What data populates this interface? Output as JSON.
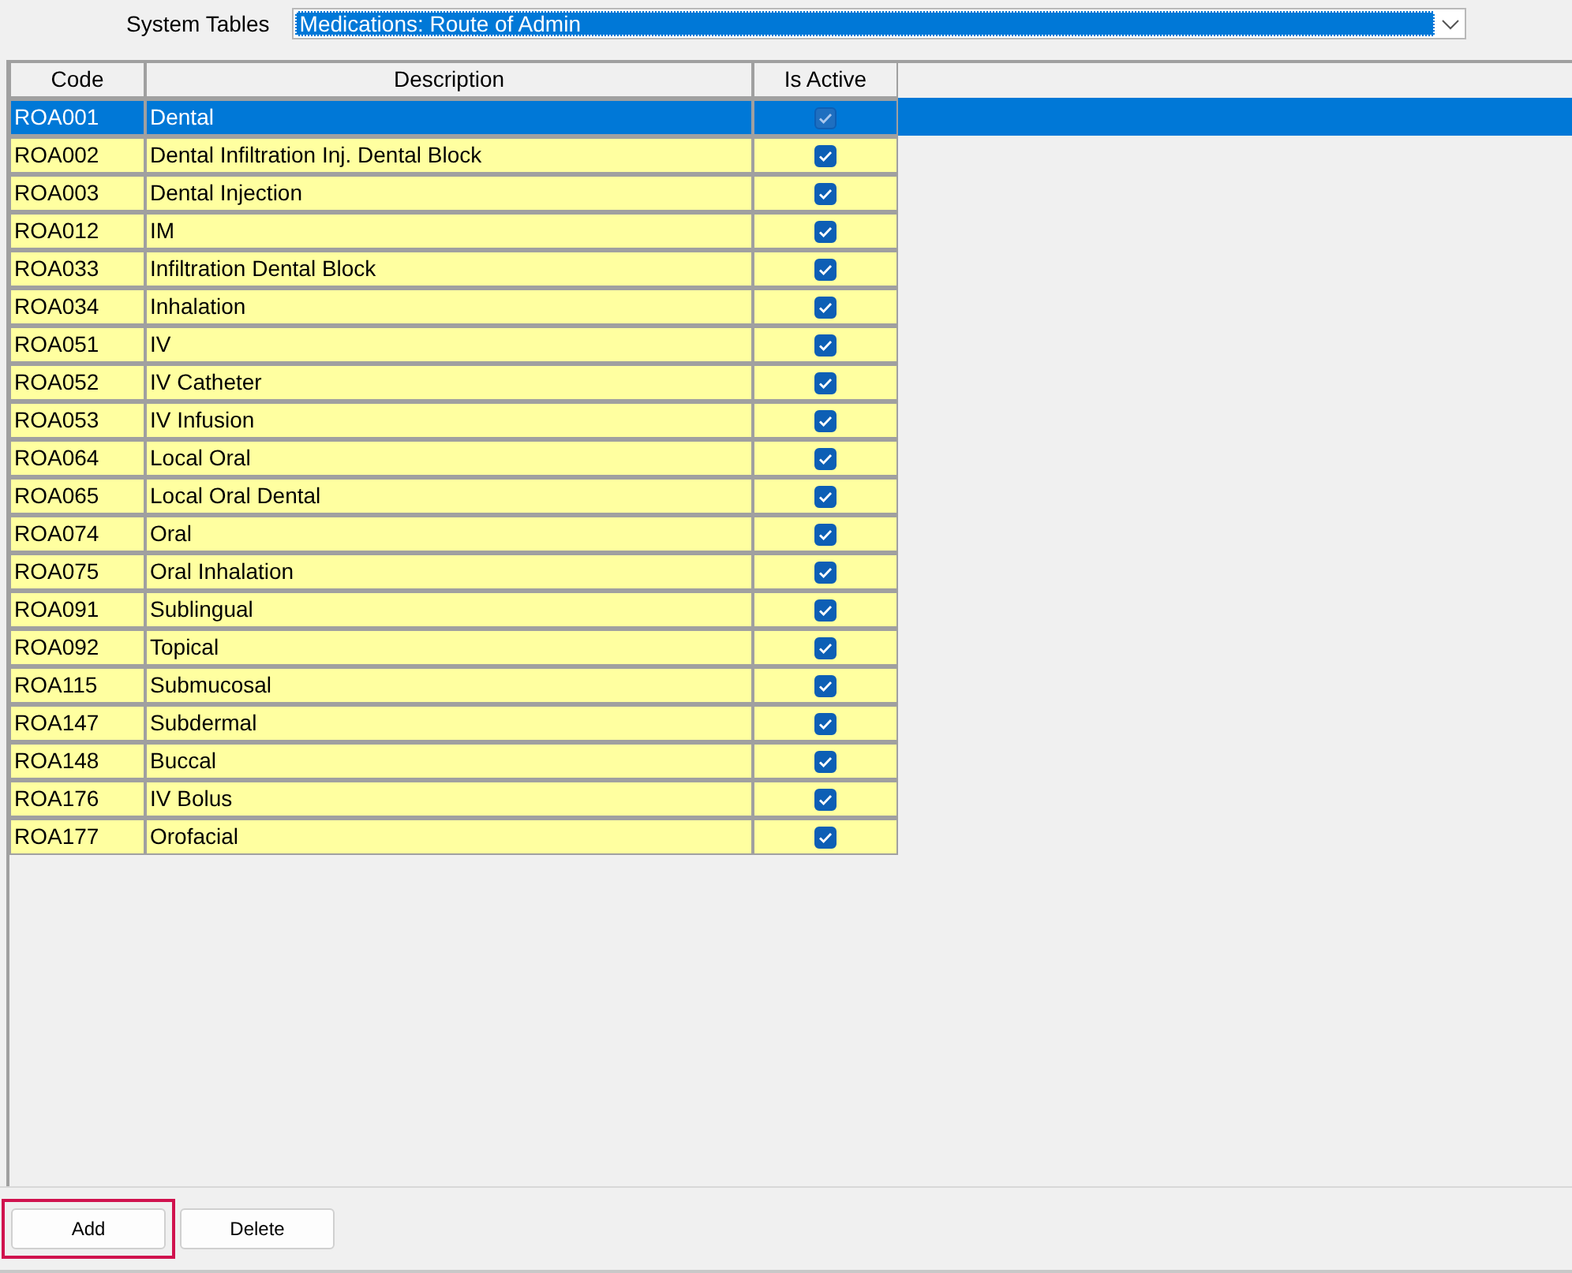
{
  "system_tables": {
    "label": "System Tables",
    "value": "Medications: Route of Admin"
  },
  "table": {
    "columns": [
      "Code",
      "Description",
      "Is Active"
    ],
    "rows": [
      {
        "code": "ROA001",
        "description": "Dental",
        "active": true,
        "selected": true
      },
      {
        "code": "ROA002",
        "description": "Dental Infiltration Inj. Dental Block",
        "active": true,
        "selected": false
      },
      {
        "code": "ROA003",
        "description": "Dental Injection",
        "active": true,
        "selected": false
      },
      {
        "code": "ROA012",
        "description": "IM",
        "active": true,
        "selected": false
      },
      {
        "code": "ROA033",
        "description": "Infiltration Dental Block",
        "active": true,
        "selected": false
      },
      {
        "code": "ROA034",
        "description": "Inhalation",
        "active": true,
        "selected": false
      },
      {
        "code": "ROA051",
        "description": "IV",
        "active": true,
        "selected": false
      },
      {
        "code": "ROA052",
        "description": "IV Catheter",
        "active": true,
        "selected": false
      },
      {
        "code": "ROA053",
        "description": "IV Infusion",
        "active": true,
        "selected": false
      },
      {
        "code": "ROA064",
        "description": "Local Oral",
        "active": true,
        "selected": false
      },
      {
        "code": "ROA065",
        "description": "Local Oral Dental",
        "active": true,
        "selected": false
      },
      {
        "code": "ROA074",
        "description": "Oral",
        "active": true,
        "selected": false
      },
      {
        "code": "ROA075",
        "description": "Oral Inhalation",
        "active": true,
        "selected": false
      },
      {
        "code": "ROA091",
        "description": "Sublingual",
        "active": true,
        "selected": false
      },
      {
        "code": "ROA092",
        "description": "Topical",
        "active": true,
        "selected": false
      },
      {
        "code": "ROA115",
        "description": "Submucosal",
        "active": true,
        "selected": false
      },
      {
        "code": "ROA147",
        "description": "Subdermal",
        "active": true,
        "selected": false
      },
      {
        "code": "ROA148",
        "description": "Buccal",
        "active": true,
        "selected": false
      },
      {
        "code": "ROA176",
        "description": "IV Bolus",
        "active": true,
        "selected": false
      },
      {
        "code": "ROA177",
        "description": "Orofacial",
        "active": true,
        "selected": false
      }
    ]
  },
  "buttons": [
    {
      "label": "Add",
      "highlighted": true
    },
    {
      "label": "Delete",
      "highlighted": false
    }
  ]
}
